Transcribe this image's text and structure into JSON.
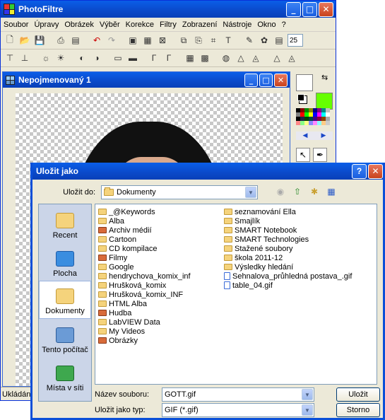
{
  "app": {
    "title": "PhotoFiltre",
    "menu": [
      "Soubor",
      "Úpravy",
      "Obrázek",
      "Výběr",
      "Korekce",
      "Filtry",
      "Zobrazení",
      "Nástroje",
      "Okno",
      "?"
    ],
    "zoom_value": "25",
    "status_text": "Ukládán"
  },
  "document": {
    "title": "Nepojmenovaný 1"
  },
  "palette": {
    "fg_color": "#ffffff",
    "bg_color": "#66ff00"
  },
  "dialog": {
    "title": "Uložit jako",
    "help_label": "?",
    "save_in_label": "Uložit do:",
    "save_in_value": "Dokumenty",
    "places": [
      {
        "label": "Recent",
        "icon": "recent-icon"
      },
      {
        "label": "Plocha",
        "icon": "desktop-icon"
      },
      {
        "label": "Dokumenty",
        "icon": "documents-icon"
      },
      {
        "label": "Tento počítač",
        "icon": "computer-icon"
      },
      {
        "label": "Místa v síti",
        "icon": "network-icon"
      }
    ],
    "files_col_a": [
      {
        "name": "_@Keywords",
        "kind": "folder"
      },
      {
        "name": "Alba",
        "kind": "folder"
      },
      {
        "name": "Archiv médií",
        "kind": "special"
      },
      {
        "name": "Cartoon",
        "kind": "folder"
      },
      {
        "name": "CD kompilace",
        "kind": "folder"
      },
      {
        "name": "Filmy",
        "kind": "special"
      },
      {
        "name": "Google",
        "kind": "folder"
      },
      {
        "name": "hendrychova_komix_inf",
        "kind": "folder"
      },
      {
        "name": "Hrušková_komix",
        "kind": "folder"
      },
      {
        "name": "Hrušková_komix_INF",
        "kind": "folder"
      },
      {
        "name": "HTML Alba",
        "kind": "folder"
      },
      {
        "name": "Hudba",
        "kind": "special"
      },
      {
        "name": "LabVIEW Data",
        "kind": "folder"
      },
      {
        "name": "My Videos",
        "kind": "folder"
      },
      {
        "name": "Obrázky",
        "kind": "special"
      }
    ],
    "files_col_b": [
      {
        "name": "seznamování Ella",
        "kind": "folder"
      },
      {
        "name": "Smajlík",
        "kind": "folder"
      },
      {
        "name": "SMART Notebook",
        "kind": "folder"
      },
      {
        "name": "SMART Technologies",
        "kind": "folder"
      },
      {
        "name": "Stažené soubory",
        "kind": "folder"
      },
      {
        "name": "škola 2011-12",
        "kind": "folder"
      },
      {
        "name": "Výsledky hledání",
        "kind": "folder"
      },
      {
        "name": "Sehnalova_průhledná postava_.gif",
        "kind": "file"
      },
      {
        "name": "table_04.gif",
        "kind": "file"
      }
    ],
    "filename_label": "Název souboru:",
    "filename_value": "GOTT.gif",
    "filetype_label": "Uložit jako typ:",
    "filetype_value": "GIF (*.gif)",
    "save_button": "Uložit",
    "cancel_button": "Storno"
  }
}
